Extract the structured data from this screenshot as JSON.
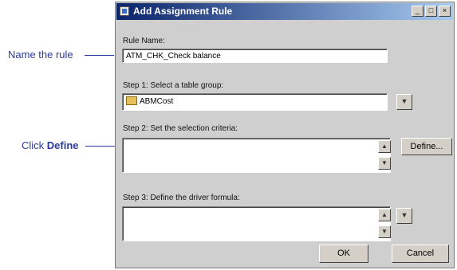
{
  "callouts": {
    "name_rule": "Name the rule",
    "click_prefix": "Click ",
    "click_bold": "Define"
  },
  "dialog": {
    "title": "Add Assignment Rule",
    "title_buttons": [
      "_",
      "□",
      "×"
    ]
  },
  "form": {
    "rule_name_label": "Rule Name:",
    "rule_name_value": "ATM_CHK_Check balance",
    "step1_label": "Step 1: Select a table group:",
    "step1_value": "ABMCost",
    "step2_label": "Step 2: Set the selection criteria:",
    "step3_label": "Step 3: Define the driver formula:",
    "define_button": "Define...",
    "ok_button": "OK",
    "cancel_button": "Cancel"
  },
  "icons": {
    "dropdown": "chevron-down-icon",
    "scroll_up": "scroll-up-icon",
    "scroll_down": "scroll-down-icon",
    "table_group": "folder-icon"
  },
  "colors": {
    "callout": "#2b3a9e",
    "title_start": "#0a246a",
    "title_end": "#a6caf0",
    "dialog_bg": "#cfcfcf"
  }
}
